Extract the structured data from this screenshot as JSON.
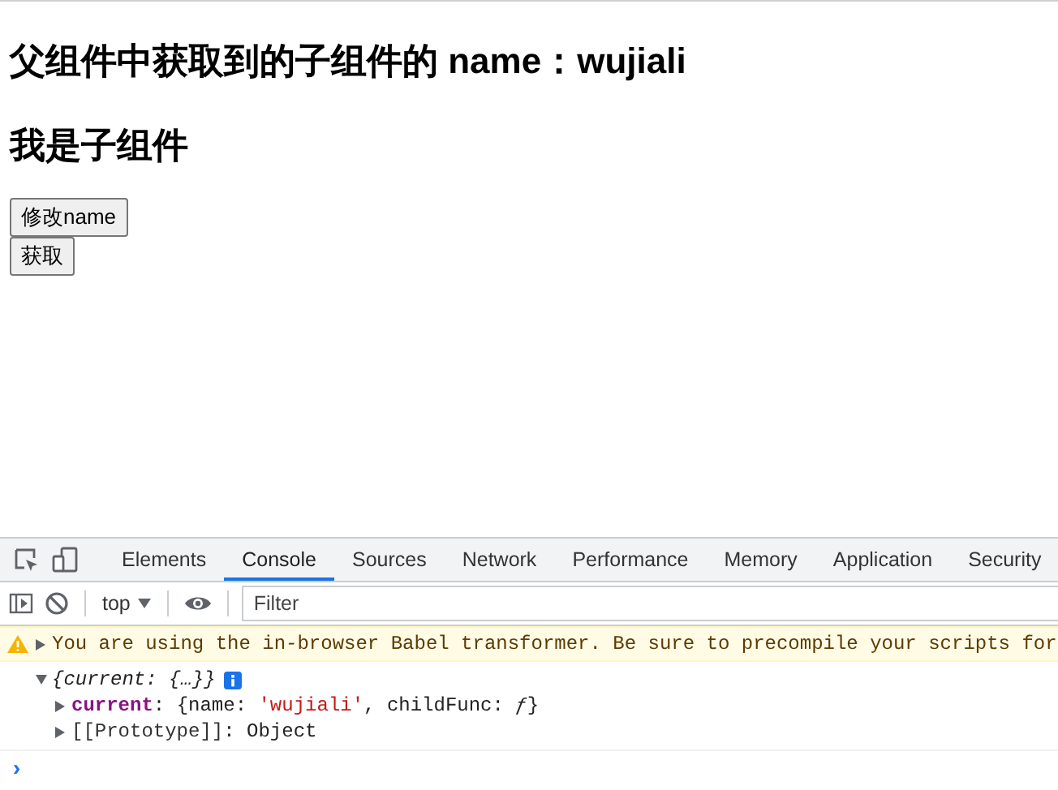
{
  "page": {
    "heading": "父组件中获取到的子组件的 name：wujiali",
    "subheading": "我是子组件",
    "buttons": [
      "修改name",
      "获取"
    ]
  },
  "devtools": {
    "tabs": [
      {
        "label": "Elements",
        "selected": false
      },
      {
        "label": "Console",
        "selected": true
      },
      {
        "label": "Sources",
        "selected": false
      },
      {
        "label": "Network",
        "selected": false
      },
      {
        "label": "Performance",
        "selected": false
      },
      {
        "label": "Memory",
        "selected": false
      },
      {
        "label": "Application",
        "selected": false
      },
      {
        "label": "Security",
        "selected": false
      }
    ],
    "context": "top",
    "filter_placeholder": "Filter",
    "messages": [
      {
        "kind": "warning",
        "expanded": false,
        "text": "You are using the in-browser Babel transformer. Be sure to precompile your scripts for"
      },
      {
        "kind": "object",
        "expanded": true,
        "summary": "{current: {…}}",
        "children": [
          {
            "kind": "property",
            "expanded": false,
            "key": "current",
            "value": [
              {
                "kind": "punct",
                "text": ": {name: "
              },
              {
                "kind": "string",
                "text": "'wujiali'"
              },
              {
                "kind": "punct",
                "text": ", childFunc: "
              },
              {
                "kind": "function",
                "text": "ƒ"
              },
              {
                "kind": "punct",
                "text": "}"
              }
            ]
          },
          {
            "kind": "internal",
            "expanded": false,
            "key": "[[Prototype]]",
            "value": [
              {
                "kind": "punct",
                "text": ": Object"
              }
            ]
          }
        ]
      }
    ],
    "prompt": "›"
  }
}
